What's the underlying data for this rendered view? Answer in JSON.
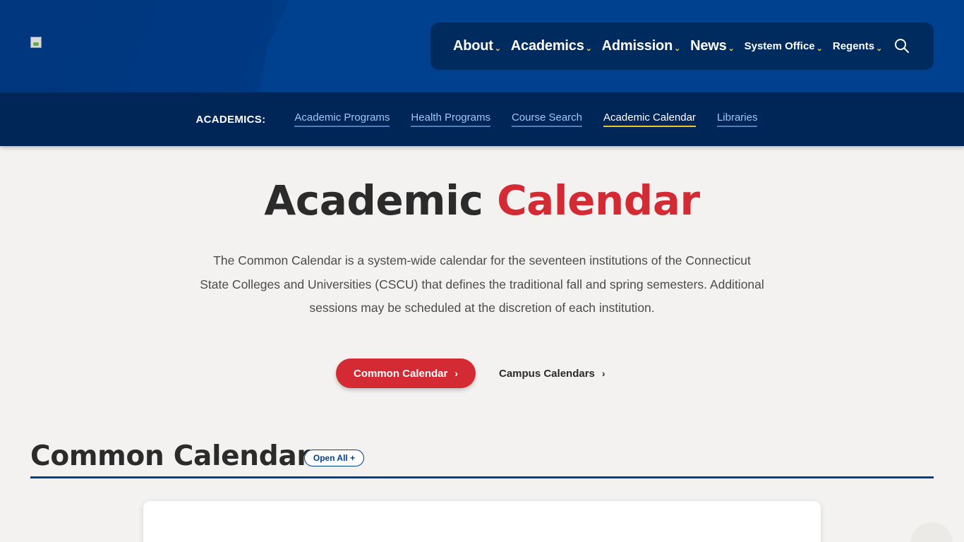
{
  "header": {
    "logo_icon": "broken-image-icon",
    "nav": [
      {
        "label": "About",
        "size": "big"
      },
      {
        "label": "Academics",
        "size": "big"
      },
      {
        "label": "Admission",
        "size": "big"
      },
      {
        "label": "News",
        "size": "big"
      },
      {
        "label": "System Office",
        "size": "small"
      },
      {
        "label": "Regents",
        "size": "small"
      }
    ],
    "search_icon": "search-icon"
  },
  "subnav": {
    "label": "ACADEMICS:",
    "links": [
      {
        "label": "Academic Programs",
        "active": false
      },
      {
        "label": "Health Programs",
        "active": false
      },
      {
        "label": "Course Search",
        "active": false
      },
      {
        "label": "Academic Calendar",
        "active": true
      },
      {
        "label": "Libraries",
        "active": false
      }
    ]
  },
  "hero": {
    "title_main": "Academic",
    "title_accent": "Calendar",
    "intro": "The Common Calendar is a system-wide calendar for the seventeen institutions of the Connecticut State Colleges and Universities (CSCU) that defines the traditional fall and spring semesters. Additional sessions may be scheduled at the discretion of each institution.",
    "primary_button": "Common Calendar",
    "secondary_button": "Campus Calendars"
  },
  "section": {
    "title": "Common Calendar",
    "open_all": "Open All +"
  },
  "colors": {
    "brand_blue": "#00418f",
    "navy": "#002658",
    "accent_red": "#d42a33",
    "accent_yellow": "#f2c230"
  }
}
